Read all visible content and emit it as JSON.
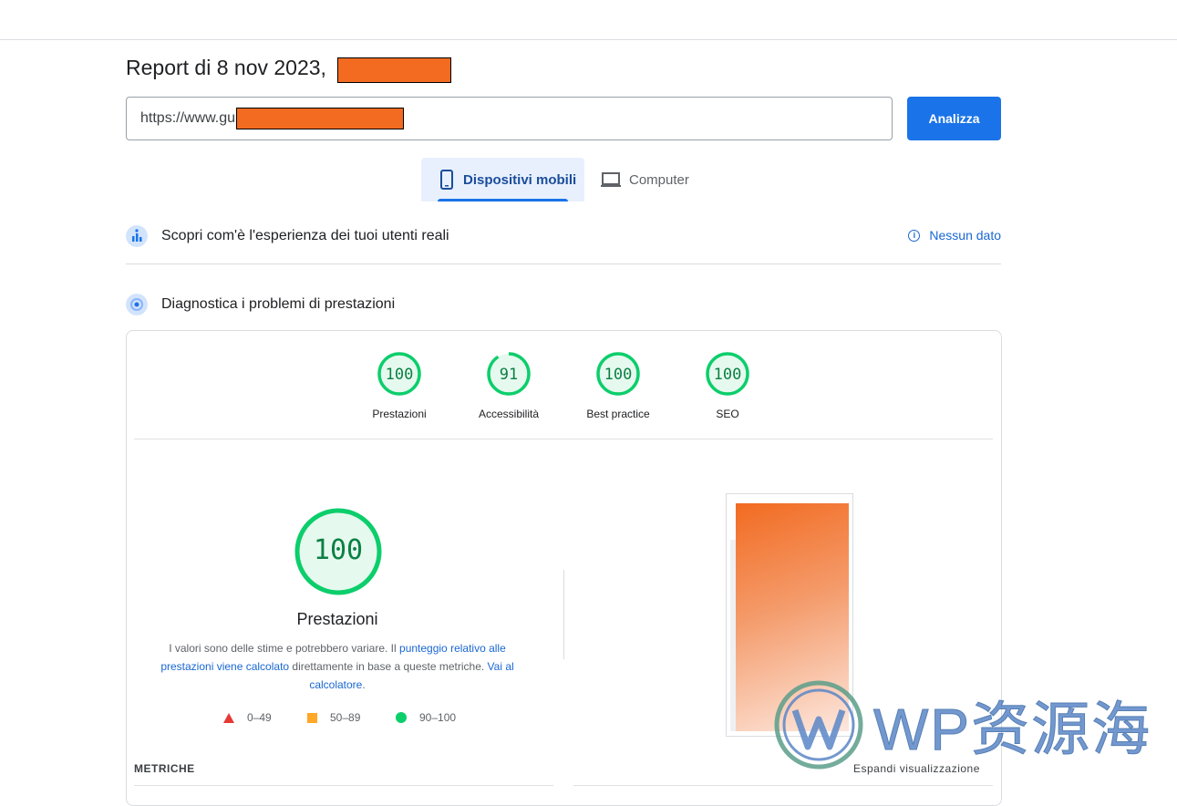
{
  "header": {
    "report_title": "Report di 8 nov 2023,"
  },
  "url_input": {
    "value": "https://www.gu"
  },
  "analyze_button": {
    "label": "Analizza"
  },
  "device_tabs": [
    {
      "label": "Dispositivi mobili",
      "icon": "smartphone-icon",
      "selected": true
    },
    {
      "label": "Computer",
      "icon": "laptop-icon",
      "selected": false
    }
  ],
  "field_data": {
    "title": "Scopri com'è l'esperienza dei tuoi utenti reali",
    "status_link": "Nessun dato"
  },
  "lab_data": {
    "title": "Diagnostica i problemi di prestazioni"
  },
  "scores": [
    {
      "label": "Prestazioni",
      "value": 100
    },
    {
      "label": "Accessibilità",
      "value": 91
    },
    {
      "label": "Best practice",
      "value": 100
    },
    {
      "label": "SEO",
      "value": 100
    }
  ],
  "performance": {
    "score": 100,
    "title": "Prestazioni",
    "desc_pre": "I valori sono delle stime e potrebbero variare. Il ",
    "desc_link1": "punteggio relativo alle prestazioni viene calcolato",
    "desc_mid": " direttamente in base a queste metriche. ",
    "desc_link2": "Vai al calcolatore",
    "desc_post": "."
  },
  "legend": [
    {
      "range": "0–49",
      "color": "#e53935",
      "shape": "triangle"
    },
    {
      "range": "50–89",
      "color": "#ffa726",
      "shape": "square"
    },
    {
      "range": "90–100",
      "color": "#0cce6b",
      "shape": "circle"
    }
  ],
  "colors": {
    "accent": "#1a73e8",
    "pass": "#0cce6b",
    "pass_text": "#0b8043",
    "redaction": "#f26b21"
  },
  "metrics_heading": "METRICHE",
  "expand_label": "Espandi visualizzazione",
  "watermark": "WP资源海"
}
